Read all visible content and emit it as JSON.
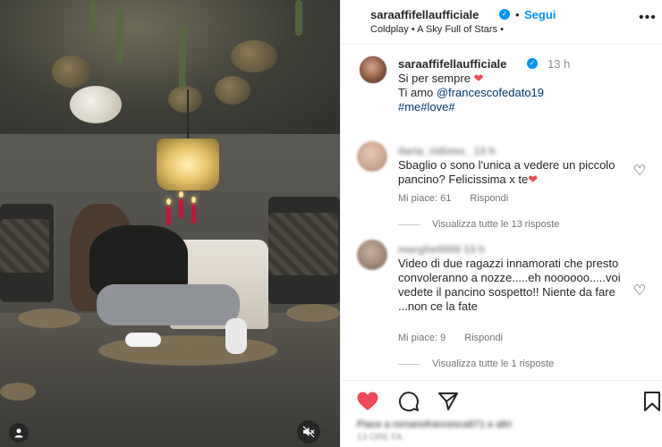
{
  "header": {
    "username": "saraaffifellaufficiale",
    "separator": "•",
    "follow_label": "Segui",
    "music": "Coldplay • A Sky Full of Stars •",
    "more_icon": "more-horizontal-icon"
  },
  "caption": {
    "username": "saraaffifellaufficiale",
    "time": "13 h",
    "line1": "Si per sempre",
    "line2_prefix": "Ti amo ",
    "mention": "@francescofedato19",
    "hashtags": "#me#love#"
  },
  "comments": [
    {
      "username": "ilaria_ridiimo_ 13 h",
      "text": "Sbaglio o sono l'unica a vedere un piccolo pancino? Felicissima x te",
      "likes": "Mi piace: 61",
      "reply": "Rispondi",
      "view_replies": "Visualizza tutte le 13 risposte"
    },
    {
      "username": "marghe0000 13 h",
      "text": "Video di due ragazzi innamorati che presto convoleranno a nozze.....eh noooooo.....voi vedete il pancino sospetto!! Niente da fare ...non ce la fate",
      "likes": "Mi piace: 9",
      "reply": "Rispondi",
      "view_replies": "Visualizza tutte le 1 risposte"
    }
  ],
  "footer": {
    "liked_by": "Piace a romanofrancesca871 e altri",
    "date": "13 ORE FA"
  },
  "colors": {
    "accent": "#0095f6",
    "like_red": "#ed4956",
    "link": "#00376b"
  }
}
